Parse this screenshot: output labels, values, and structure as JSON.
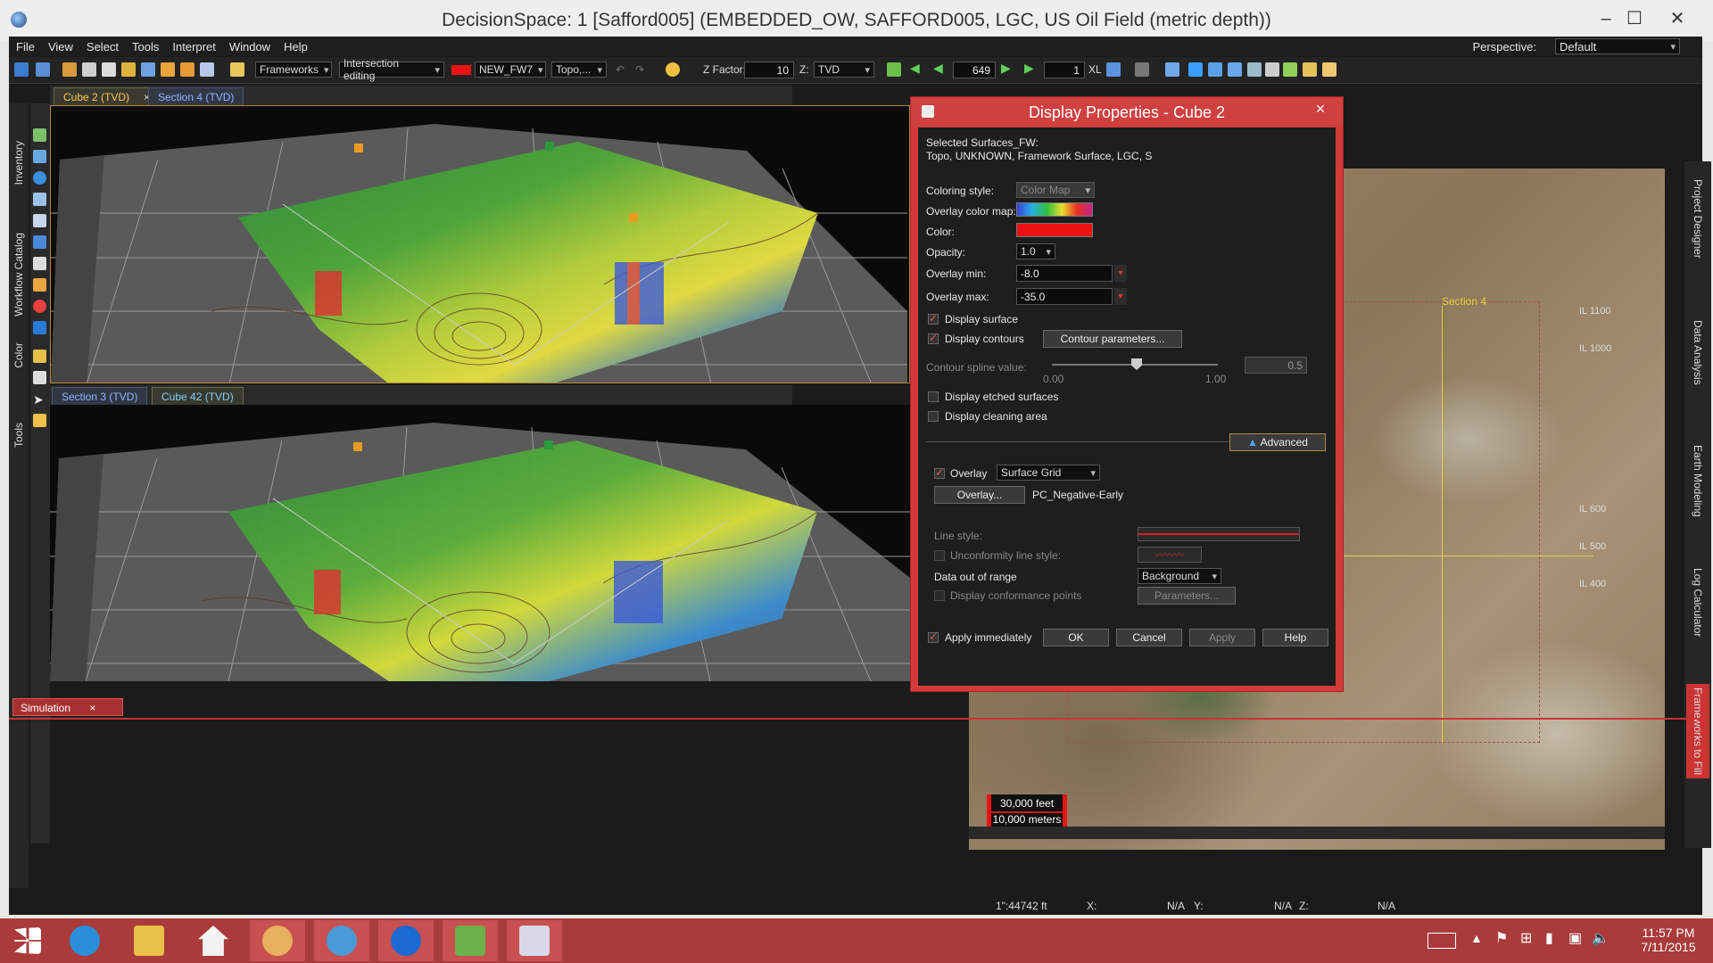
{
  "window": {
    "title": "DecisionSpace: 1 [Safford005] (EMBEDDED_OW, SAFFORD005, LGC, US Oil Field (metric depth))"
  },
  "menu": [
    "File",
    "View",
    "Select",
    "Tools",
    "Interpret",
    "Window",
    "Help"
  ],
  "perspective": {
    "label": "Perspective:",
    "value": "Default"
  },
  "toolbar": {
    "frameworks": "Frameworks",
    "intersection": "Intersection editing",
    "framework_name": "NEW_FW7",
    "topo": "Topo,...",
    "zfactor_label": "Z Factor:",
    "zfactor_value": "10",
    "z_label": "Z:",
    "z_value": "TVD",
    "slice_value": "649",
    "step_value": "1",
    "xl_label": "XL"
  },
  "left_strip": [
    "Inventory",
    "Workflow Catalog",
    "Color",
    "Tools"
  ],
  "right_strip": [
    "Project Designer",
    "Data Analysis",
    "Earth Modeling",
    "Log Calculator",
    "Frameworks to Fill"
  ],
  "top_pane": {
    "tabs": [
      {
        "label": "Cube 2 (TVD)",
        "close": "×"
      },
      {
        "label": "Section 4 (TVD)"
      }
    ]
  },
  "bottom_pane": {
    "tabs": [
      {
        "label": "Section 3 (TVD)"
      },
      {
        "label": "Cube 42 (TVD)"
      }
    ]
  },
  "dialog": {
    "title": "Display Properties - Cube 2",
    "close": "×",
    "selected_label": "Selected Surfaces_FW:",
    "selected_value": "Topo, UNKNOWN, Framework Surface, LGC, S",
    "coloring_style_label": "Coloring style:",
    "coloring_style_value": "Color Map",
    "overlay_colormap_label": "Overlay color map:",
    "color_label": "Color:",
    "opacity_label": "Opacity:",
    "opacity_value": "1.0",
    "overlay_min_label": "Overlay min:",
    "overlay_min_value": "-8.0",
    "overlay_max_label": "Overlay max:",
    "overlay_max_value": "-35.0",
    "display_surface": "Display surface",
    "display_contours": "Display contours",
    "contour_params": "Contour parameters...",
    "spline_label": "Contour spline value:",
    "spline_min": "0.00",
    "spline_max": "1.00",
    "spline_value": "0.5",
    "etched": "Display etched surfaces",
    "cleaning": "Display cleaning area",
    "advanced": "Advanced",
    "overlay_label": "Overlay",
    "overlay_type": "Surface Grid",
    "overlay_btn": "Overlay...",
    "overlay_name": "PC_Negative-Early",
    "line_style": "Line style:",
    "unconformity": "Unconformity line style:",
    "out_of_range_label": "Data out of range",
    "out_of_range_value": "Background",
    "conformance": "Display conformance points",
    "parameters": "Parameters...",
    "apply_immediately": "Apply immediately",
    "ok": "OK",
    "cancel": "Cancel",
    "apply": "Apply",
    "help": "Help"
  },
  "map": {
    "section_label": "Section 4",
    "il_labels": [
      "IL 1100",
      "IL 1000",
      "IL 600",
      "IL 500",
      "IL 400"
    ],
    "scale_feet": "30,000 feet",
    "scale_meters": "10,000 meters"
  },
  "bottom_tab": {
    "label": "Simulation",
    "close": "×"
  },
  "status": {
    "scale": "1\":44742 ft",
    "x_label": "X:",
    "x_value": "N/A",
    "y_label": "Y:",
    "y_value": "N/A",
    "z_label": "Z:",
    "z_value": "N/A"
  },
  "taskbar": {
    "time": "11:57 PM",
    "date": "7/11/2015"
  },
  "colors": {
    "accent": "#d33b3b",
    "tab_active": "#ffc94d",
    "tab_inactive": "#8fb3ff",
    "section_line": "#e6d23a"
  }
}
